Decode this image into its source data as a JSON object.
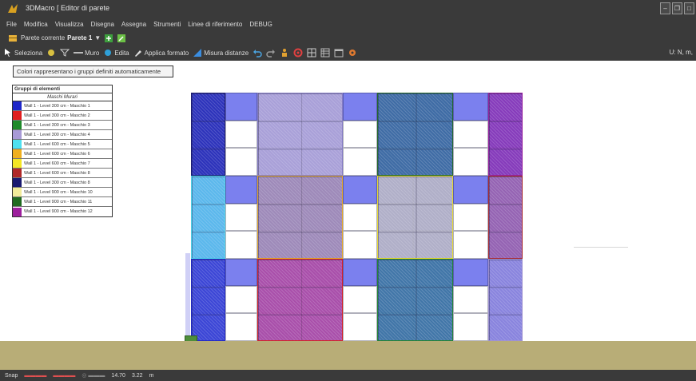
{
  "window": {
    "title": "3DMacro [ Editor di parete",
    "controls": {
      "minimize": "–",
      "restore": "❐",
      "close": "□"
    }
  },
  "menu": [
    "File",
    "Modifica",
    "Visualizza",
    "Disegna",
    "Assegna",
    "Strumenti",
    "Linee di riferimento",
    "DEBUG"
  ],
  "toolbar1": {
    "label": "Parete corrente",
    "wall_select": "Parete 1",
    "dropdown_arrow": "▼"
  },
  "toolbar2": {
    "select": "Seleziona",
    "wall": "Muro",
    "edit": "Edita",
    "apply_format": "Applica formato",
    "measure": "Misura distanze",
    "right_readout": "U: N, m,"
  },
  "canvas": {
    "groups_button": "Colori rappresentano i gruppi definiti automaticamente",
    "legend": {
      "title": "Gruppi di elementi",
      "header": "Maschi Murari",
      "rows": [
        {
          "label": "Wall 1 - Level 300 cm - Maschio 1",
          "color": "#1f27c9"
        },
        {
          "label": "Wall 1 - Level 300 cm - Maschio 2",
          "color": "#e01e1e"
        },
        {
          "label": "Wall 1 - Level 300 cm - Maschio 3",
          "color": "#1f8a2a"
        },
        {
          "label": "Wall 1 - Level 300 cm - Maschio 4",
          "color": "#a89ad6"
        },
        {
          "label": "Wall 1 - Level 600 cm - Maschio 5",
          "color": "#4fe0f0"
        },
        {
          "label": "Wall 1 - Level 600 cm - Maschio 6",
          "color": "#f0b020"
        },
        {
          "label": "Wall 1 - Level 600 cm - Maschio 7",
          "color": "#f5e625"
        },
        {
          "label": "Wall 1 - Level 600 cm - Maschio 8",
          "color": "#b02828"
        },
        {
          "label": "Wall 1 - Level 300 cm - Maschio 8",
          "color": "#1a1a70"
        },
        {
          "label": "Wall 1 - Level 900 cm - Maschio 10",
          "color": "#f1eb9a"
        },
        {
          "label": "Wall 1 - Level 900 cm - Maschio 11",
          "color": "#1f6a1f"
        },
        {
          "label": "Wall 1 - Level 900 cm - Maschio 12",
          "color": "#9d1f9d"
        }
      ]
    }
  },
  "statusbar": {
    "snap": "Snap",
    "coord_a": "14.70",
    "coord_b": "3.22",
    "unit": "m"
  }
}
